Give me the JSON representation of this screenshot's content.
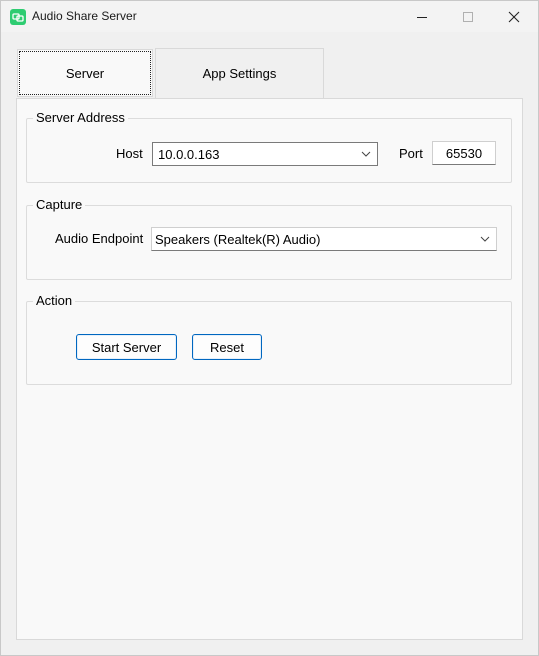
{
  "window": {
    "title": "Audio Share Server",
    "icons": [
      "app-icon",
      "minimize-icon",
      "maximize-icon",
      "close-icon"
    ]
  },
  "tabs": [
    {
      "label": "Server",
      "selected": true
    },
    {
      "label": "App Settings",
      "selected": false
    }
  ],
  "server_address": {
    "group_label": "Server Address",
    "host_label": "Host",
    "host_value": "10.0.0.163",
    "port_label": "Port",
    "port_value": "65530"
  },
  "capture": {
    "group_label": "Capture",
    "endpoint_label": "Audio Endpoint",
    "endpoint_value": "Speakers (Realtek(R) Audio)"
  },
  "action": {
    "group_label": "Action",
    "start_label": "Start Server",
    "reset_label": "Reset"
  },
  "colors": {
    "accent": "#0067c0",
    "app_icon": "#2ecc71"
  }
}
